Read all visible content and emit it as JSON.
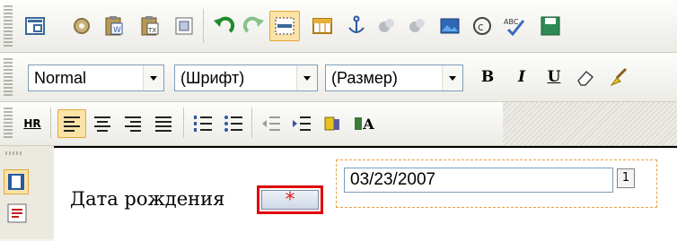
{
  "toolbar1": {
    "icons": [
      "preview-icon",
      "settings-icon",
      "paste-word-icon",
      "paste-text-icon",
      "paste-image-icon",
      "undo-icon",
      "redo-icon",
      "select-all-icon",
      "table-icon",
      "anchor-icon",
      "link-icon",
      "unlink-icon",
      "image-icon",
      "copyright-icon",
      "spellcheck-icon",
      "save-icon"
    ]
  },
  "toolbar2": {
    "format": "Normal",
    "font": "(Шрифт)",
    "size": "(Размер)",
    "bold": "B",
    "italic": "I",
    "underline": "U"
  },
  "toolbar3": {
    "hr": "HR",
    "font_color": "A"
  },
  "form": {
    "label": "Дата рождения",
    "required_mark": "*",
    "date_value": "03/23/2007",
    "calendar_label": "1"
  },
  "colors": {
    "active_bg": "#fbe3a6",
    "active_border": "#e6a53b",
    "required_border": "#e00000",
    "required_star": "#e02020",
    "dashed_border": "#e8a044"
  }
}
